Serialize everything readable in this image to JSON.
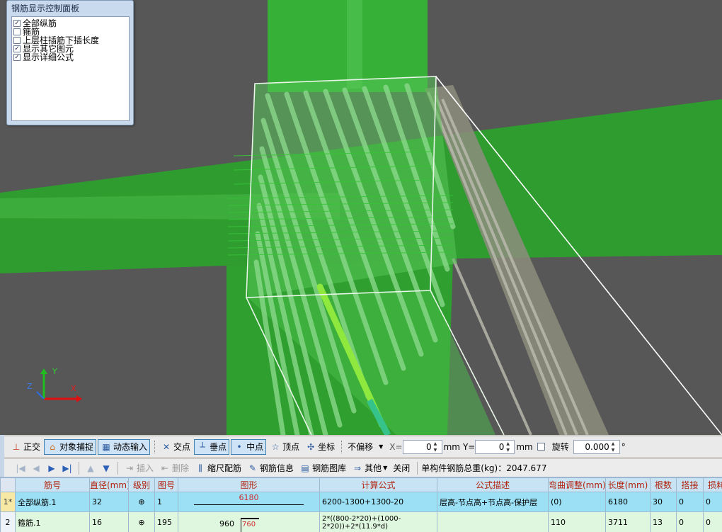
{
  "panel": {
    "title": "钢筋显示控制面板",
    "options": [
      {
        "label": "全部纵筋",
        "checked": true
      },
      {
        "label": "箍筋",
        "checked": false
      },
      {
        "label": "上层柱插筋下插长度",
        "checked": false
      },
      {
        "label": "显示其它图元",
        "checked": true
      },
      {
        "label": "显示详细公式",
        "checked": true
      }
    ]
  },
  "axes": {
    "x": "X",
    "y": "Y",
    "z": "Z"
  },
  "toolbar1": {
    "ortho": "正交",
    "snap": "对象捕捉",
    "dyn_input": "动态输入",
    "intersection": "交点",
    "perpendicular": "垂点",
    "midpoint": "中点",
    "vertex": "顶点",
    "coordinate": "坐标",
    "offset_mode": "不偏移",
    "x_label": "X=",
    "x_value": "0",
    "y_label": "Y=",
    "y_value": "0",
    "unit_x": "mm",
    "unit_y": "mm",
    "rotate": "旋转",
    "rotate_value": "0.000",
    "degree": "°"
  },
  "toolbar2": {
    "insert": "插入",
    "delete": "删除",
    "scale_rebar": "缩尺配筋",
    "rebar_info": "钢筋信息",
    "rebar_library": "钢筋图库",
    "other": "其他",
    "close": "关闭",
    "total_weight": "单构件钢筋总重(kg)：2047.677"
  },
  "table": {
    "headers": [
      "筋号",
      "直径(mm)",
      "级别",
      "图号",
      "图形",
      "计算公式",
      "公式描述",
      "弯曲调整(mm)",
      "长度(mm)",
      "根数",
      "搭接",
      "损耗"
    ],
    "rows": [
      {
        "idx": "1*",
        "name": "全部纵筋.1",
        "dia": "32",
        "grade": "⊕",
        "fig": "1",
        "shape_value": "6180",
        "formula": "6200-1300+1300-20",
        "desc": "层高-节点高+节点高-保护层",
        "bend": "(0)",
        "length": "6180",
        "count": "30",
        "lap": "0",
        "loss": "0"
      },
      {
        "idx": "2",
        "name": "箍筋.1",
        "dia": "16",
        "grade": "⊕",
        "fig": "195",
        "shape_value": "960",
        "shape_value2": "760",
        "formula": "2*((800-2*20)+(1000-2*20))+2*(11.9*d)",
        "desc": "",
        "bend": "110",
        "length": "3711",
        "count": "13",
        "lap": "0",
        "loss": "0"
      }
    ]
  },
  "colors": {
    "beam_green": "#2e9e2e",
    "column_green": "#3ab53a",
    "bg_grey": "#575757",
    "header_red": "#b3240f"
  }
}
